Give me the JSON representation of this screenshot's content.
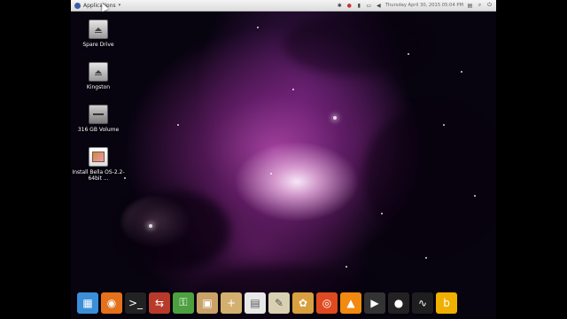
{
  "topbar": {
    "applications_label": "Applications",
    "clock": "Thursday April 30, 2015 05:04 PM",
    "tray_icons": [
      "bluetooth-icon",
      "record-icon",
      "signal-icon",
      "battery-icon",
      "volume-icon"
    ]
  },
  "desktop_icons": [
    {
      "label": "Spare Drive",
      "icon": "drive-icon"
    },
    {
      "label": "Kingston",
      "icon": "usb-drive-icon"
    },
    {
      "label": "316 GB Volume",
      "icon": "volume-drive-icon"
    },
    {
      "label": "Install Bella OS-2.2-64bit ...",
      "icon": "installer-icon"
    }
  ],
  "dock": [
    {
      "name": "file-manager",
      "glyph": "▦",
      "color": "#3a8fd8"
    },
    {
      "name": "firefox",
      "glyph": "◉",
      "color": "#e5711c"
    },
    {
      "name": "terminal",
      "glyph": ">_",
      "color": "#222222"
    },
    {
      "name": "network-tool",
      "glyph": "⇆",
      "color": "#b83a2a"
    },
    {
      "name": "keyring",
      "glyph": "⚿",
      "color": "#4ca040"
    },
    {
      "name": "archive-manager",
      "glyph": "▣",
      "color": "#c9a26a"
    },
    {
      "name": "package-installer",
      "glyph": "+",
      "color": "#d4b070"
    },
    {
      "name": "text-document",
      "glyph": "▤",
      "color": "#e8e8e8"
    },
    {
      "name": "text-editor",
      "glyph": "✎",
      "color": "#d8d0b0"
    },
    {
      "name": "paint-app",
      "glyph": "✿",
      "color": "#d8a040"
    },
    {
      "name": "disc-burner",
      "glyph": "◎",
      "color": "#e04a20"
    },
    {
      "name": "vlc-player",
      "glyph": "▲",
      "color": "#f08a10"
    },
    {
      "name": "video-editor",
      "glyph": "▶",
      "color": "#333333"
    },
    {
      "name": "disk-utility",
      "glyph": "●",
      "color": "#222222"
    },
    {
      "name": "system-monitor",
      "glyph": "∿",
      "color": "#1e1e1e"
    },
    {
      "name": "bella-launcher",
      "glyph": "b",
      "color": "#f0b000"
    }
  ]
}
